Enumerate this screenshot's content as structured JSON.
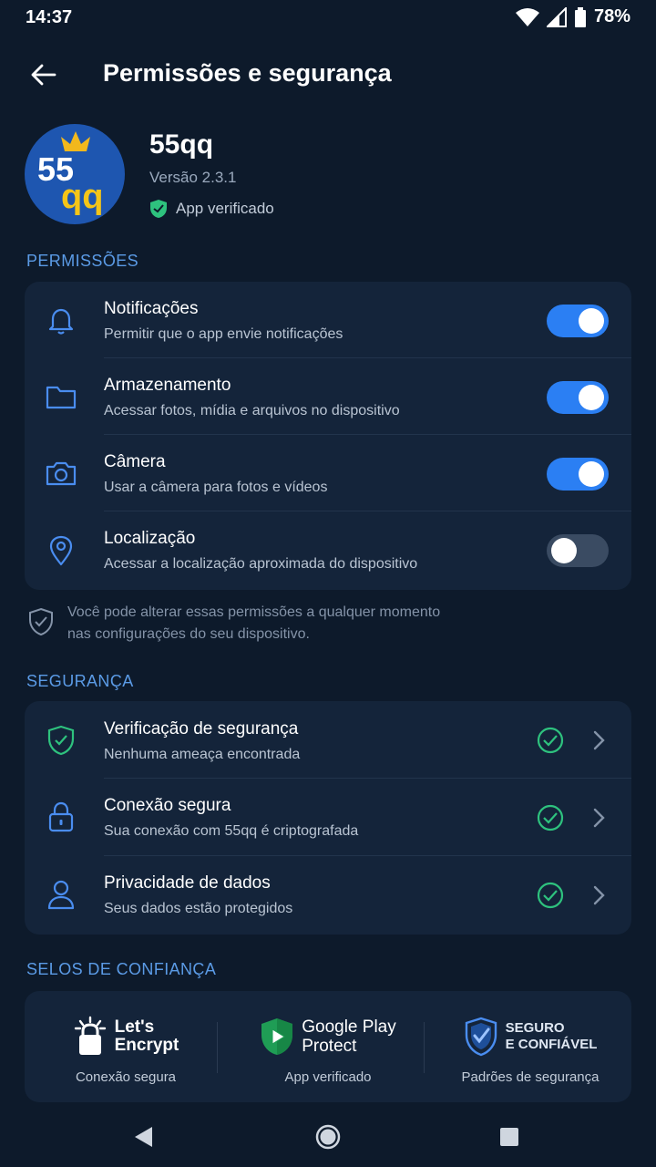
{
  "status_bar": {
    "time": "14:37",
    "battery": "78%"
  },
  "app_bar": {
    "title": "Permissões e segurança"
  },
  "app": {
    "logo_text": "55qq",
    "name": "55qq",
    "version": "Versão 2.3.1",
    "verified": "App verificado"
  },
  "permissions": {
    "section_title": "PERMISSÕES",
    "items": [
      {
        "title": "Notificações",
        "subtitle": "Permitir que o app envie notificações",
        "icon": "bell-icon",
        "enabled": true
      },
      {
        "title": "Armazenamento",
        "subtitle": "Acessar fotos, mídia e arquivos no dispositivo",
        "icon": "folder-icon",
        "enabled": true
      },
      {
        "title": "Câmera",
        "subtitle": "Usar a câmera para fotos e vídeos",
        "icon": "camera-icon",
        "enabled": true
      },
      {
        "title": "Localização",
        "subtitle": "Acessar a localização aproximada do dispositivo",
        "icon": "location-pin-icon",
        "enabled": false
      }
    ],
    "note_line1": "Você pode alterar essas permissões a qualquer momento",
    "note_line2": "nas configurações do seu dispositivo."
  },
  "security": {
    "section_title": "SEGURANÇA",
    "items": [
      {
        "title": "Verificação de segurança",
        "subtitle": "Nenhuma ameaça encontrada",
        "icon": "shield-check-icon"
      },
      {
        "title": "Conexão segura",
        "subtitle": "Sua conexão com 55qq é criptografada",
        "icon": "lock-icon"
      },
      {
        "title": "Privacidade de dados",
        "subtitle": "Seus dados estão protegidos",
        "icon": "user-icon"
      }
    ]
  },
  "trust_seals": {
    "section_title": "SELOS DE CONFIANÇA",
    "items": [
      {
        "logo_line1": "Let's",
        "logo_line2": "Encrypt",
        "caption": "Conexão segura"
      },
      {
        "logo_line1": "Google Play",
        "logo_line2": "Protect",
        "caption": "App verificado"
      },
      {
        "logo_line1": "SEGURO",
        "logo_line2": "E CONFIÁVEL",
        "caption": "Padrões de segurança"
      }
    ]
  },
  "colors": {
    "background": "#0d1a2b",
    "card": "#14243a",
    "accent": "#2b7ff3",
    "section_title": "#5b9be6",
    "success": "#2ec27e"
  }
}
